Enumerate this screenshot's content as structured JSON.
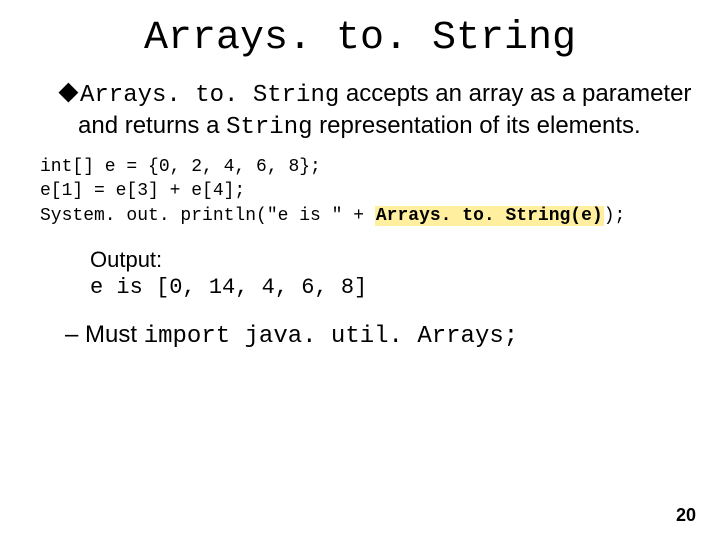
{
  "title": "Arrays. to. String",
  "body": {
    "mono1": "Arrays. to. String",
    "text1": " accepts an array as a parameter and returns a ",
    "mono2": "String",
    "text2": " representation of its elements."
  },
  "code": {
    "l1": "int[] e = {0, 2, 4, 6, 8};",
    "l2": "e[1] = e[3] + e[4];",
    "l3a": "System. out. println(\"e is \" + ",
    "l3hl": "Arrays. to. String(e)",
    "l3b": ");"
  },
  "output": {
    "label": "Output:",
    "line": "e is [0, 14, 4, 6, 8]"
  },
  "must": {
    "dash": "– Must ",
    "code": "import java. util. Arrays;"
  },
  "page": "20"
}
